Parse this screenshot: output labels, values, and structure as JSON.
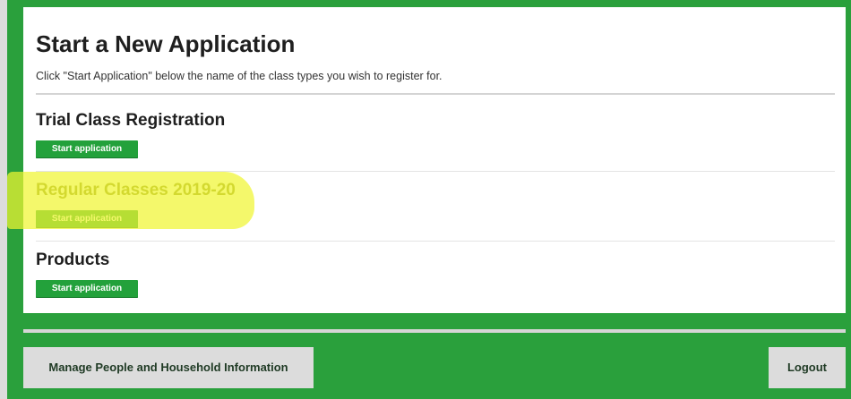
{
  "panel": {
    "title": "Start a New Application",
    "subtitle": "Click \"Start Application\" below the name of the class types you wish to register for."
  },
  "sections": [
    {
      "title": "Trial Class Registration",
      "button_label": "Start application"
    },
    {
      "title": "Regular Classes 2019-20",
      "button_label": "Start application"
    },
    {
      "title": "Products",
      "button_label": "Start application"
    }
  ],
  "footer": {
    "manage_label": "Manage People and Household Information",
    "logout_label": "Logout"
  },
  "colors": {
    "brand_green": "#2aa03c",
    "button_green": "#23a13b",
    "highlight_yellow": "#f0f532"
  }
}
